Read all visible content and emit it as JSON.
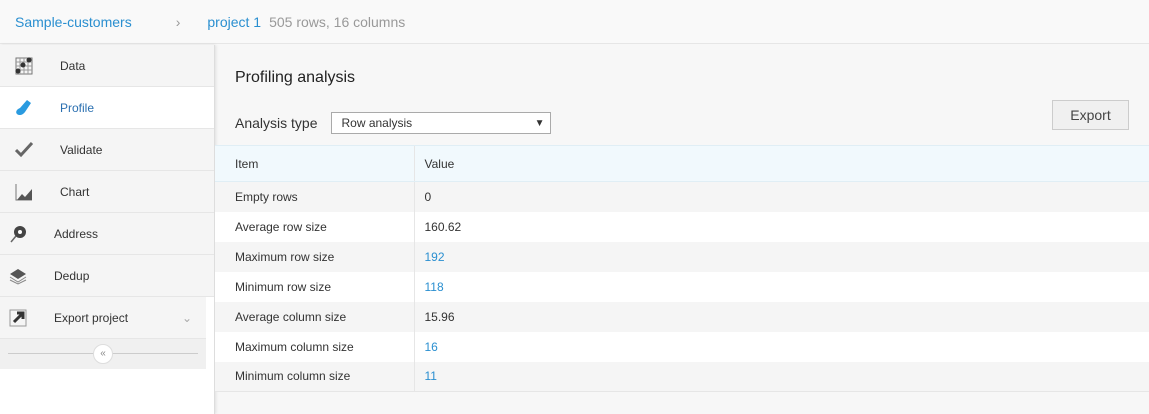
{
  "breadcrumb": {
    "dataset": "Sample-customers",
    "project": "project 1",
    "meta": "505 rows, 16 columns"
  },
  "sidebar": {
    "items": [
      {
        "label": "Data",
        "icon": "grid-icon"
      },
      {
        "label": "Profile",
        "icon": "flask-icon"
      },
      {
        "label": "Validate",
        "icon": "check-icon"
      },
      {
        "label": "Chart",
        "icon": "chart-icon"
      },
      {
        "label": "Address",
        "icon": "map-pin-icon"
      },
      {
        "label": "Dedup",
        "icon": "layers-icon"
      },
      {
        "label": "Export project",
        "icon": "export-icon"
      }
    ],
    "collapse": "«"
  },
  "main": {
    "title": "Profiling analysis",
    "analysis_label": "Analysis type",
    "analysis_value": "Row analysis",
    "export": "Export",
    "headers": [
      "Item",
      "Value"
    ],
    "rows": [
      {
        "item": "Empty rows",
        "value": "0"
      },
      {
        "item": "Average row size",
        "value": "160.62"
      },
      {
        "item": "Maximum row size",
        "value": "192"
      },
      {
        "item": "Minimum row size",
        "value": "118"
      },
      {
        "item": "Average column size",
        "value": "15.96"
      },
      {
        "item": "Maximum column size",
        "value": "16"
      },
      {
        "item": "Minimum column size",
        "value": "11"
      }
    ]
  }
}
